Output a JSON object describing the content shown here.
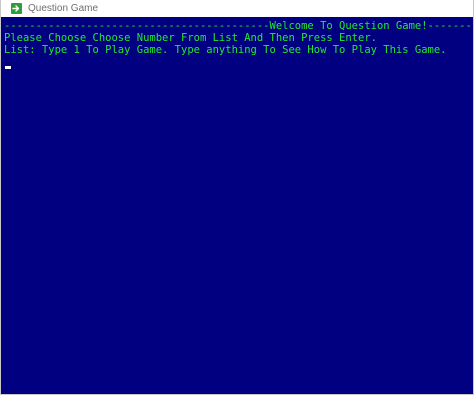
{
  "window": {
    "title": "Question Game"
  },
  "icons": {
    "app": "console-app-icon"
  },
  "colors": {
    "console_background": "#010080",
    "console_text": "#22e832",
    "cursor": "#ffffff"
  },
  "console": {
    "lines": [
      "------------------------------------------Welcome To Question Game!--------",
      "Please Choose Choose Number From List And Then Press Enter.",
      "List: Type 1 To Play Game. Type anything To See How To Play This Game."
    ]
  }
}
